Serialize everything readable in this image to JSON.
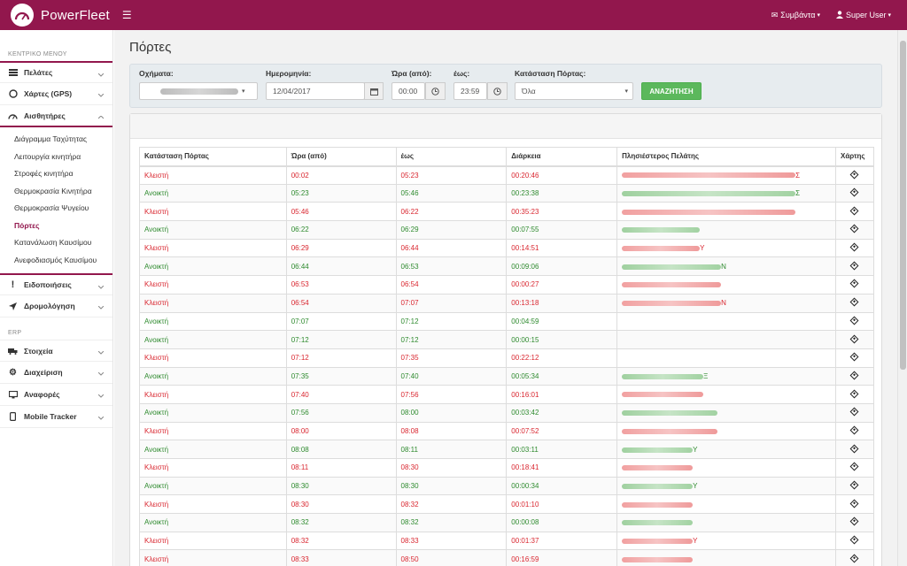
{
  "app": {
    "brand": "PowerFleet"
  },
  "header": {
    "events_label": "Συμβάντα",
    "user_label": "Super User"
  },
  "sidebar": {
    "main_menu_title": "ΚΕΝΤΡΙΚΟ ΜΕΝΟΥ",
    "items": [
      {
        "label": "Πελάτες",
        "icon": "users-icon"
      },
      {
        "label": "Χάρτες (GPS)",
        "icon": "globe-icon"
      },
      {
        "label": "Αισθητήρες",
        "icon": "dashboard-icon"
      }
    ],
    "sensors_sub": [
      "Διάγραμμα Ταχύτητας",
      "Λειτουργία κινητήρα",
      "Στροφές κινητήρα",
      "Θερμοκρασία Κινητήρα",
      "Θερμοκρασία Ψυγείου",
      "Πόρτες",
      "Κατανάλωση Καυσίμου",
      "Ανεφοδιασμός Καυσίμου"
    ],
    "items2": [
      {
        "label": "Ειδοποιήσεις",
        "icon": "exclamation-icon"
      },
      {
        "label": "Δρομολόγηση",
        "icon": "location-arrow-icon"
      }
    ],
    "erp_title": "ERP",
    "erp_items": [
      {
        "label": "Στοιχεία",
        "icon": "truck-icon"
      },
      {
        "label": "Διαχείριση",
        "icon": "gear-icon"
      },
      {
        "label": "Αναφορές",
        "icon": "desktop-icon"
      },
      {
        "label": "Mobile Tracker",
        "icon": "mobile-icon"
      }
    ]
  },
  "page": {
    "title": "Πόρτες"
  },
  "filters": {
    "vehicles_label": "Οχήματα:",
    "date_label": "Ημερομηνία:",
    "date_value": "12/04/2017",
    "time_from_label": "Ώρα (από):",
    "time_from_value": "00:00",
    "time_to_label": "έως:",
    "time_to_value": "23:59",
    "door_state_label": "Κατάσταση Πόρτας:",
    "door_state_value": "Όλα",
    "search_label": "ΑΝΑΖΗΤΗΣΗ"
  },
  "table": {
    "headers": [
      "Κατάσταση Πόρτας",
      "Ώρα (από)",
      "έως",
      "Διάρκεια",
      "Πλησιέστερος Πελάτης",
      "Χάρτης"
    ],
    "rows": [
      {
        "state": "Κλειστή",
        "from": "00:02",
        "to": "05:23",
        "duration": "00:20:46",
        "color": "red",
        "client_tail": "Σ",
        "client_w": 196
      },
      {
        "state": "Ανοικτή",
        "from": "05:23",
        "to": "05:46",
        "duration": "00:23:38",
        "color": "green",
        "client_tail": "Σ",
        "client_w": 196
      },
      {
        "state": "Κλειστή",
        "from": "05:46",
        "to": "06:22",
        "duration": "00:35:23",
        "color": "red",
        "client_tail": "",
        "client_w": 196
      },
      {
        "state": "Ανοικτή",
        "from": "06:22",
        "to": "06:29",
        "duration": "00:07:55",
        "color": "green",
        "client_tail": "",
        "client_w": 88
      },
      {
        "state": "Κλειστή",
        "from": "06:29",
        "to": "06:44",
        "duration": "00:14:51",
        "color": "red",
        "client_tail": "Υ",
        "client_w": 88
      },
      {
        "state": "Ανοικτή",
        "from": "06:44",
        "to": "06:53",
        "duration": "00:09:06",
        "color": "green",
        "client_tail": "Ν",
        "client_w": 112
      },
      {
        "state": "Κλειστή",
        "from": "06:53",
        "to": "06:54",
        "duration": "00:00:27",
        "color": "red",
        "client_tail": "",
        "client_w": 112
      },
      {
        "state": "Κλειστή",
        "from": "06:54",
        "to": "07:07",
        "duration": "00:13:18",
        "color": "red",
        "client_tail": "Ν",
        "client_w": 112
      },
      {
        "state": "Ανοικτή",
        "from": "07:07",
        "to": "07:12",
        "duration": "00:04:59",
        "color": "green",
        "client_tail": "",
        "client_w": 0
      },
      {
        "state": "Ανοικτή",
        "from": "07:12",
        "to": "07:12",
        "duration": "00:00:15",
        "color": "green",
        "client_tail": "",
        "client_w": 0
      },
      {
        "state": "Κλειστή",
        "from": "07:12",
        "to": "07:35",
        "duration": "00:22:12",
        "color": "red",
        "client_tail": "",
        "client_w": 0
      },
      {
        "state": "Ανοικτή",
        "from": "07:35",
        "to": "07:40",
        "duration": "00:05:34",
        "color": "green",
        "client_tail": "Ξ",
        "client_w": 92
      },
      {
        "state": "Κλειστή",
        "from": "07:40",
        "to": "07:56",
        "duration": "00:16:01",
        "color": "red",
        "client_tail": "",
        "client_w": 92
      },
      {
        "state": "Ανοικτή",
        "from": "07:56",
        "to": "08:00",
        "duration": "00:03:42",
        "color": "green",
        "client_tail": "",
        "client_w": 108
      },
      {
        "state": "Κλειστή",
        "from": "08:00",
        "to": "08:08",
        "duration": "00:07:52",
        "color": "red",
        "client_tail": "",
        "client_w": 108
      },
      {
        "state": "Ανοικτή",
        "from": "08:08",
        "to": "08:11",
        "duration": "00:03:11",
        "color": "green",
        "client_tail": "Υ",
        "client_w": 80
      },
      {
        "state": "Κλειστή",
        "from": "08:11",
        "to": "08:30",
        "duration": "00:18:41",
        "color": "red",
        "client_tail": "",
        "client_w": 80
      },
      {
        "state": "Ανοικτή",
        "from": "08:30",
        "to": "08:30",
        "duration": "00:00:34",
        "color": "green",
        "client_tail": "Υ",
        "client_w": 80
      },
      {
        "state": "Κλειστή",
        "from": "08:30",
        "to": "08:32",
        "duration": "00:01:10",
        "color": "red",
        "client_tail": "",
        "client_w": 80
      },
      {
        "state": "Ανοικτή",
        "from": "08:32",
        "to": "08:32",
        "duration": "00:00:08",
        "color": "green",
        "client_tail": "",
        "client_w": 80
      },
      {
        "state": "Κλειστή",
        "from": "08:32",
        "to": "08:33",
        "duration": "00:01:37",
        "color": "red",
        "client_tail": "Υ",
        "client_w": 80
      },
      {
        "state": "Κλειστή",
        "from": "08:33",
        "to": "08:50",
        "duration": "00:16:59",
        "color": "red",
        "client_tail": "",
        "client_w": 80
      }
    ]
  },
  "colors": {
    "brand": "#92174d",
    "closed": "#d9262f",
    "open": "#2e8a2e",
    "search_button": "#5cb85c"
  }
}
